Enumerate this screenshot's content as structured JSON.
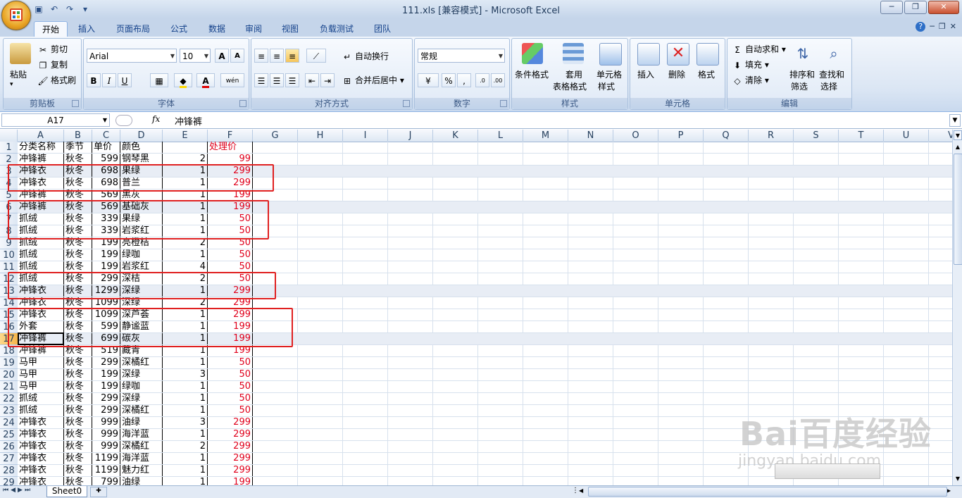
{
  "window": {
    "title": "111.xls  [兼容模式] - Microsoft Excel",
    "controls": [
      "─",
      "❐",
      "✕"
    ]
  },
  "ribbon_tabs": [
    "开始",
    "插入",
    "页面布局",
    "公式",
    "数据",
    "审阅",
    "视图",
    "负载测试",
    "团队"
  ],
  "ribbon": {
    "clipboard": {
      "label": "剪贴板",
      "paste": "粘贴",
      "cut": "剪切",
      "copy": "复制",
      "format_painter": "格式刷"
    },
    "font": {
      "label": "字体",
      "font_name": "Arial",
      "font_size": "10",
      "bold": "B",
      "italic": "I",
      "underline": "U"
    },
    "alignment": {
      "label": "对齐方式",
      "wrap": "自动换行",
      "merge": "合并后居中"
    },
    "number": {
      "label": "数字",
      "format": "常规"
    },
    "styles": {
      "label": "样式",
      "cond_format": "条件格式",
      "table_format_1": "套用",
      "table_format_2": "表格格式",
      "cell_style_1": "单元格",
      "cell_style_2": "样式"
    },
    "cells": {
      "label": "单元格",
      "insert": "插入",
      "delete": "删除",
      "format": "格式"
    },
    "editing": {
      "label": "编辑",
      "autosum": "自动求和",
      "fill": "填充",
      "clear": "清除",
      "sort_1": "排序和",
      "sort_2": "筛选",
      "find_1": "查找和",
      "find_2": "选择"
    }
  },
  "formula_bar": {
    "name_box": "A17",
    "fx": "fx",
    "value": "冲锋裤"
  },
  "columns": [
    "A",
    "B",
    "C",
    "D",
    "E",
    "F",
    "G",
    "H",
    "I",
    "J",
    "K",
    "L",
    "M",
    "N",
    "O",
    "P",
    "Q",
    "R",
    "S",
    "T",
    "U",
    "V"
  ],
  "table": {
    "header": [
      "分类名称",
      "季节",
      "单价",
      "颜色",
      "",
      "处理价"
    ],
    "rows": [
      [
        "冲锋裤",
        "秋冬",
        "599",
        "钢琴黑",
        "2",
        "99"
      ],
      [
        "冲锋衣",
        "秋冬",
        "698",
        "果绿",
        "1",
        "299"
      ],
      [
        "冲锋衣",
        "秋冬",
        "698",
        "普兰",
        "1",
        "299"
      ],
      [
        "冲锋裤",
        "秋冬",
        "569",
        "黑灰",
        "1",
        "199"
      ],
      [
        "冲锋裤",
        "秋冬",
        "569",
        "基础灰",
        "1",
        "199"
      ],
      [
        "抓绒",
        "秋冬",
        "339",
        "果绿",
        "1",
        "50"
      ],
      [
        "抓绒",
        "秋冬",
        "339",
        "岩浆红",
        "1",
        "50"
      ],
      [
        "抓绒",
        "秋冬",
        "199",
        "亮橙桔",
        "2",
        "50"
      ],
      [
        "抓绒",
        "秋冬",
        "199",
        "绿咖",
        "1",
        "50"
      ],
      [
        "抓绒",
        "秋冬",
        "199",
        "岩浆红",
        "4",
        "50"
      ],
      [
        "抓绒",
        "秋冬",
        "299",
        "深桔",
        "2",
        "50"
      ],
      [
        "冲锋衣",
        "秋冬",
        "1299",
        "深绿",
        "1",
        "299"
      ],
      [
        "冲锋衣",
        "秋冬",
        "1099",
        "深绿",
        "2",
        "299"
      ],
      [
        "冲锋衣",
        "秋冬",
        "1099",
        "深芦荟",
        "1",
        "299"
      ],
      [
        "外套",
        "秋冬",
        "599",
        "静谧蓝",
        "1",
        "199"
      ],
      [
        "冲锋裤",
        "秋冬",
        "699",
        "碳灰",
        "1",
        "199"
      ],
      [
        "冲锋裤",
        "秋冬",
        "519",
        "藏青",
        "1",
        "199"
      ],
      [
        "马甲",
        "秋冬",
        "299",
        "深橘红",
        "1",
        "50"
      ],
      [
        "马甲",
        "秋冬",
        "199",
        "深绿",
        "3",
        "50"
      ],
      [
        "马甲",
        "秋冬",
        "199",
        "绿咖",
        "1",
        "50"
      ],
      [
        "抓绒",
        "秋冬",
        "299",
        "深绿",
        "1",
        "50"
      ],
      [
        "抓绒",
        "秋冬",
        "299",
        "深橘红",
        "1",
        "50"
      ],
      [
        "冲锋衣",
        "秋冬",
        "999",
        "油绿",
        "3",
        "299"
      ],
      [
        "冲锋衣",
        "秋冬",
        "999",
        "海洋蓝",
        "1",
        "299"
      ],
      [
        "冲锋衣",
        "秋冬",
        "999",
        "深橘红",
        "2",
        "299"
      ],
      [
        "冲锋衣",
        "秋冬",
        "1199",
        "海洋蓝",
        "1",
        "299"
      ],
      [
        "冲锋衣",
        "秋冬",
        "1199",
        "魅力红",
        "1",
        "299"
      ],
      [
        "冲锋衣",
        "秋冬",
        "799",
        "油绿",
        "1",
        "199"
      ]
    ]
  },
  "row_numbers": [
    "1",
    "2",
    "3",
    "4",
    "5",
    "6",
    "7",
    "8",
    "9",
    "10",
    "11",
    "12",
    "13",
    "14",
    "15",
    "16",
    "17",
    "18",
    "19",
    "20",
    "21",
    "22",
    "23",
    "24",
    "25",
    "26",
    "27",
    "28",
    "29"
  ],
  "selected_row": "17",
  "highlighted_rows": [
    3,
    6,
    13,
    17
  ],
  "sheet_tab": "Sheet0",
  "watermark": {
    "brand": "Bai百度经验",
    "site": "jingyan.baidu.com"
  },
  "colors": {
    "accent": "#e02020",
    "price_red": "#e0001b",
    "ribbon_blue": "#15428b"
  }
}
